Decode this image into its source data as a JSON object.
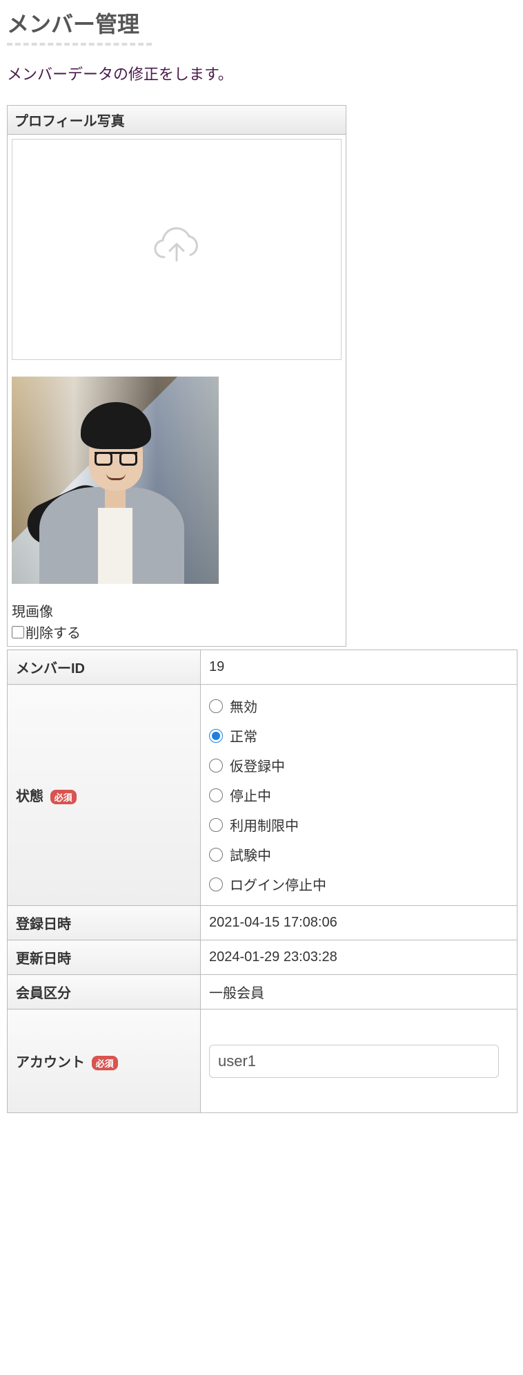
{
  "page": {
    "title": "メンバー管理",
    "subtitle": "メンバーデータの修正をします。"
  },
  "photo_panel": {
    "header": "プロフィール写真",
    "current_label": "現画像",
    "delete_label": "削除する"
  },
  "form": {
    "member_id": {
      "label": "メンバーID",
      "value": "19"
    },
    "status": {
      "label": "状態",
      "required_badge": "必須",
      "options": [
        "無効",
        "正常",
        "仮登録中",
        "停止中",
        "利用制限中",
        "試験中",
        "ログイン停止中"
      ],
      "selected_index": 1
    },
    "created_at": {
      "label": "登録日時",
      "value": "2021-04-15 17:08:06"
    },
    "updated_at": {
      "label": "更新日時",
      "value": "2024-01-29 23:03:28"
    },
    "member_type": {
      "label": "会員区分",
      "value": "一般会員"
    },
    "account": {
      "label": "アカウント",
      "required_badge": "必須",
      "value": "user1"
    }
  }
}
